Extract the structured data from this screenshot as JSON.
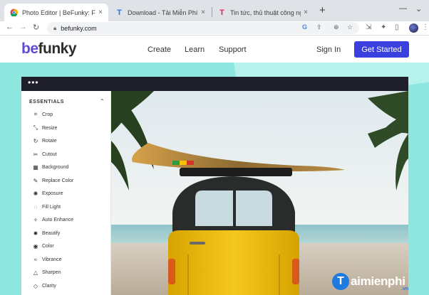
{
  "browser": {
    "tabs": [
      {
        "title": "Photo Editor | BeFunky: Free O",
        "active": true,
        "favicon": "chrome-icon"
      },
      {
        "title": "Download - Tải Miễn Phí VN -",
        "active": false,
        "favicon": "taimienphi-t-icon"
      },
      {
        "title": "Tin tức, thủ thuật công nghệ -",
        "active": false,
        "favicon": "thuthuat-t-icon"
      }
    ],
    "new_tab": "+",
    "close_glyph": "×",
    "url": "befunky.com"
  },
  "site": {
    "logo_prefix": "be",
    "logo_rest": "funky",
    "nav": [
      "Create",
      "Learn",
      "Support"
    ],
    "sign_in": "Sign In",
    "get_started": "Get Started"
  },
  "editor": {
    "menu_dots": "•••",
    "section_title": "ESSENTIALS",
    "tools": [
      {
        "label": "Crop",
        "icon": "crop-icon"
      },
      {
        "label": "Resize",
        "icon": "resize-icon"
      },
      {
        "label": "Rotate",
        "icon": "rotate-icon"
      },
      {
        "label": "Cutout",
        "icon": "cutout-icon"
      },
      {
        "label": "Background",
        "icon": "background-icon"
      },
      {
        "label": "Replace Color",
        "icon": "eyedropper-icon"
      },
      {
        "label": "Exposure",
        "icon": "exposure-icon"
      },
      {
        "label": "Fill Light",
        "icon": "fill-light-icon"
      },
      {
        "label": "Auto Enhance",
        "icon": "auto-enhance-icon"
      },
      {
        "label": "Beautify",
        "icon": "beautify-icon"
      },
      {
        "label": "Color",
        "icon": "color-icon"
      },
      {
        "label": "Vibrance",
        "icon": "vibrance-icon"
      },
      {
        "label": "Sharpen",
        "icon": "sharpen-icon"
      },
      {
        "label": "Clarity",
        "icon": "clarity-icon"
      }
    ]
  },
  "watermark": {
    "brand": "aimienphi",
    "initial": "T",
    "suffix": ".vn"
  },
  "colors": {
    "accent": "#3a3fe0",
    "hero": "#8ee7df",
    "editor_bar": "#1f1f2b",
    "van_yellow": "#f1c21b"
  }
}
